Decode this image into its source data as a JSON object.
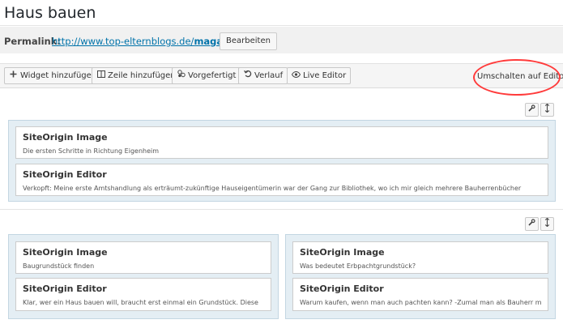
{
  "page_title": "Haus bauen",
  "permalink": {
    "label": "Permalink:",
    "url_base": "http://www.top-elternblogs.de/",
    "url_slug": "magazin",
    "url_tail": "/",
    "edit_label": "Bearbeiten"
  },
  "toolbar": {
    "add_widget": "Widget hinzufügen",
    "add_row": "Zeile hinzufügen",
    "prebuilt": "Vorgefertigt",
    "history": "Verlauf",
    "live_editor": "Live Editor",
    "switch_editor": "Umschalten auf Editor"
  },
  "icons": {
    "add_widget": "plus-icon",
    "add_row": "columns-icon",
    "prebuilt": "layout-icon",
    "history": "undo-icon",
    "live_editor": "eye-icon",
    "wrench": "wrench-icon",
    "move": "move-icon"
  },
  "rows": [
    {
      "cells": [
        {
          "widgets": [
            {
              "title": "SiteOrigin Image",
              "desc": "Die ersten Schritte in Richtung Eigenheim"
            },
            {
              "title": "SiteOrigin Editor",
              "desc": "Verkopft: Meine erste Amtshandlung als erträumt-zukünftige Hauseigentümerin war der Gang zur Bibliothek, wo ich mir gleich mehrere Bauherrenbücher"
            }
          ]
        }
      ]
    },
    {
      "cells": [
        {
          "widgets": [
            {
              "title": "SiteOrigin Image",
              "desc": "Baugrundstück finden"
            },
            {
              "title": "SiteOrigin Editor",
              "desc": "Klar, wer ein Haus bauen will, braucht erst einmal ein Grundstück. Diese"
            }
          ]
        },
        {
          "widgets": [
            {
              "title": "SiteOrigin Image",
              "desc": "Was bedeutet Erbpachtgrundstück?"
            },
            {
              "title": "SiteOrigin Editor",
              "desc": "Warum kaufen, wenn man auch pachten kann? -Zumal man als Bauherr mit"
            }
          ]
        }
      ]
    }
  ],
  "colors": {
    "highlight": "#ff3b3b",
    "link": "#0073aa",
    "row_bg": "#e4eef4"
  }
}
